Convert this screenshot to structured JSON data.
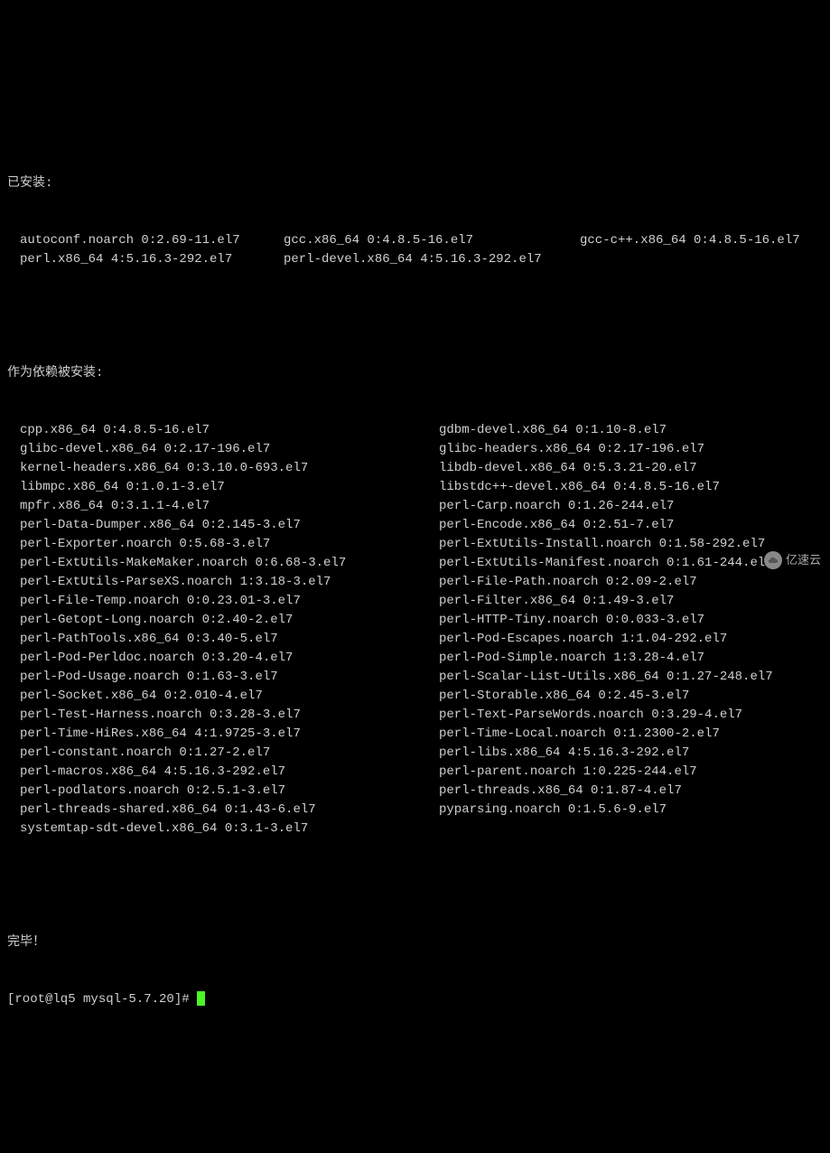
{
  "headers": {
    "installed": "已安装:",
    "deps_installed": "作为依赖被安装:",
    "complete": "完毕！"
  },
  "installed": [
    [
      "autoconf.noarch 0:2.69-11.el7",
      "gcc.x86_64 0:4.8.5-16.el7",
      "gcc-c++.x86_64 0:4.8.5-16.el7"
    ],
    [
      "perl.x86_64 4:5.16.3-292.el7",
      "perl-devel.x86_64 4:5.16.3-292.el7",
      ""
    ]
  ],
  "deps": [
    [
      "cpp.x86_64 0:4.8.5-16.el7",
      "gdbm-devel.x86_64 0:1.10-8.el7"
    ],
    [
      "glibc-devel.x86_64 0:2.17-196.el7",
      "glibc-headers.x86_64 0:2.17-196.el7"
    ],
    [
      "kernel-headers.x86_64 0:3.10.0-693.el7",
      "libdb-devel.x86_64 0:5.3.21-20.el7"
    ],
    [
      "libmpc.x86_64 0:1.0.1-3.el7",
      "libstdc++-devel.x86_64 0:4.8.5-16.el7"
    ],
    [
      "mpfr.x86_64 0:3.1.1-4.el7",
      "perl-Carp.noarch 0:1.26-244.el7"
    ],
    [
      "perl-Data-Dumper.x86_64 0:2.145-3.el7",
      "perl-Encode.x86_64 0:2.51-7.el7"
    ],
    [
      "perl-Exporter.noarch 0:5.68-3.el7",
      "perl-ExtUtils-Install.noarch 0:1.58-292.el7"
    ],
    [
      "perl-ExtUtils-MakeMaker.noarch 0:6.68-3.el7",
      "perl-ExtUtils-Manifest.noarch 0:1.61-244.el7"
    ],
    [
      "perl-ExtUtils-ParseXS.noarch 1:3.18-3.el7",
      "perl-File-Path.noarch 0:2.09-2.el7"
    ],
    [
      "perl-File-Temp.noarch 0:0.23.01-3.el7",
      "perl-Filter.x86_64 0:1.49-3.el7"
    ],
    [
      "perl-Getopt-Long.noarch 0:2.40-2.el7",
      "perl-HTTP-Tiny.noarch 0:0.033-3.el7"
    ],
    [
      "perl-PathTools.x86_64 0:3.40-5.el7",
      "perl-Pod-Escapes.noarch 1:1.04-292.el7"
    ],
    [
      "perl-Pod-Perldoc.noarch 0:3.20-4.el7",
      "perl-Pod-Simple.noarch 1:3.28-4.el7"
    ],
    [
      "perl-Pod-Usage.noarch 0:1.63-3.el7",
      "perl-Scalar-List-Utils.x86_64 0:1.27-248.el7"
    ],
    [
      "perl-Socket.x86_64 0:2.010-4.el7",
      "perl-Storable.x86_64 0:2.45-3.el7"
    ],
    [
      "perl-Test-Harness.noarch 0:3.28-3.el7",
      "perl-Text-ParseWords.noarch 0:3.29-4.el7"
    ],
    [
      "perl-Time-HiRes.x86_64 4:1.9725-3.el7",
      "perl-Time-Local.noarch 0:1.2300-2.el7"
    ],
    [
      "perl-constant.noarch 0:1.27-2.el7",
      "perl-libs.x86_64 4:5.16.3-292.el7"
    ],
    [
      "perl-macros.x86_64 4:5.16.3-292.el7",
      "perl-parent.noarch 1:0.225-244.el7"
    ],
    [
      "perl-podlators.noarch 0:2.5.1-3.el7",
      "perl-threads.x86_64 0:1.87-4.el7"
    ],
    [
      "perl-threads-shared.x86_64 0:1.43-6.el7",
      "pyparsing.noarch 0:1.5.6-9.el7"
    ],
    [
      "systemtap-sdt-devel.x86_64 0:3.1-3.el7",
      ""
    ]
  ],
  "prompt": "[root@lq5 mysql-5.7.20]# ",
  "watermark": "亿速云"
}
